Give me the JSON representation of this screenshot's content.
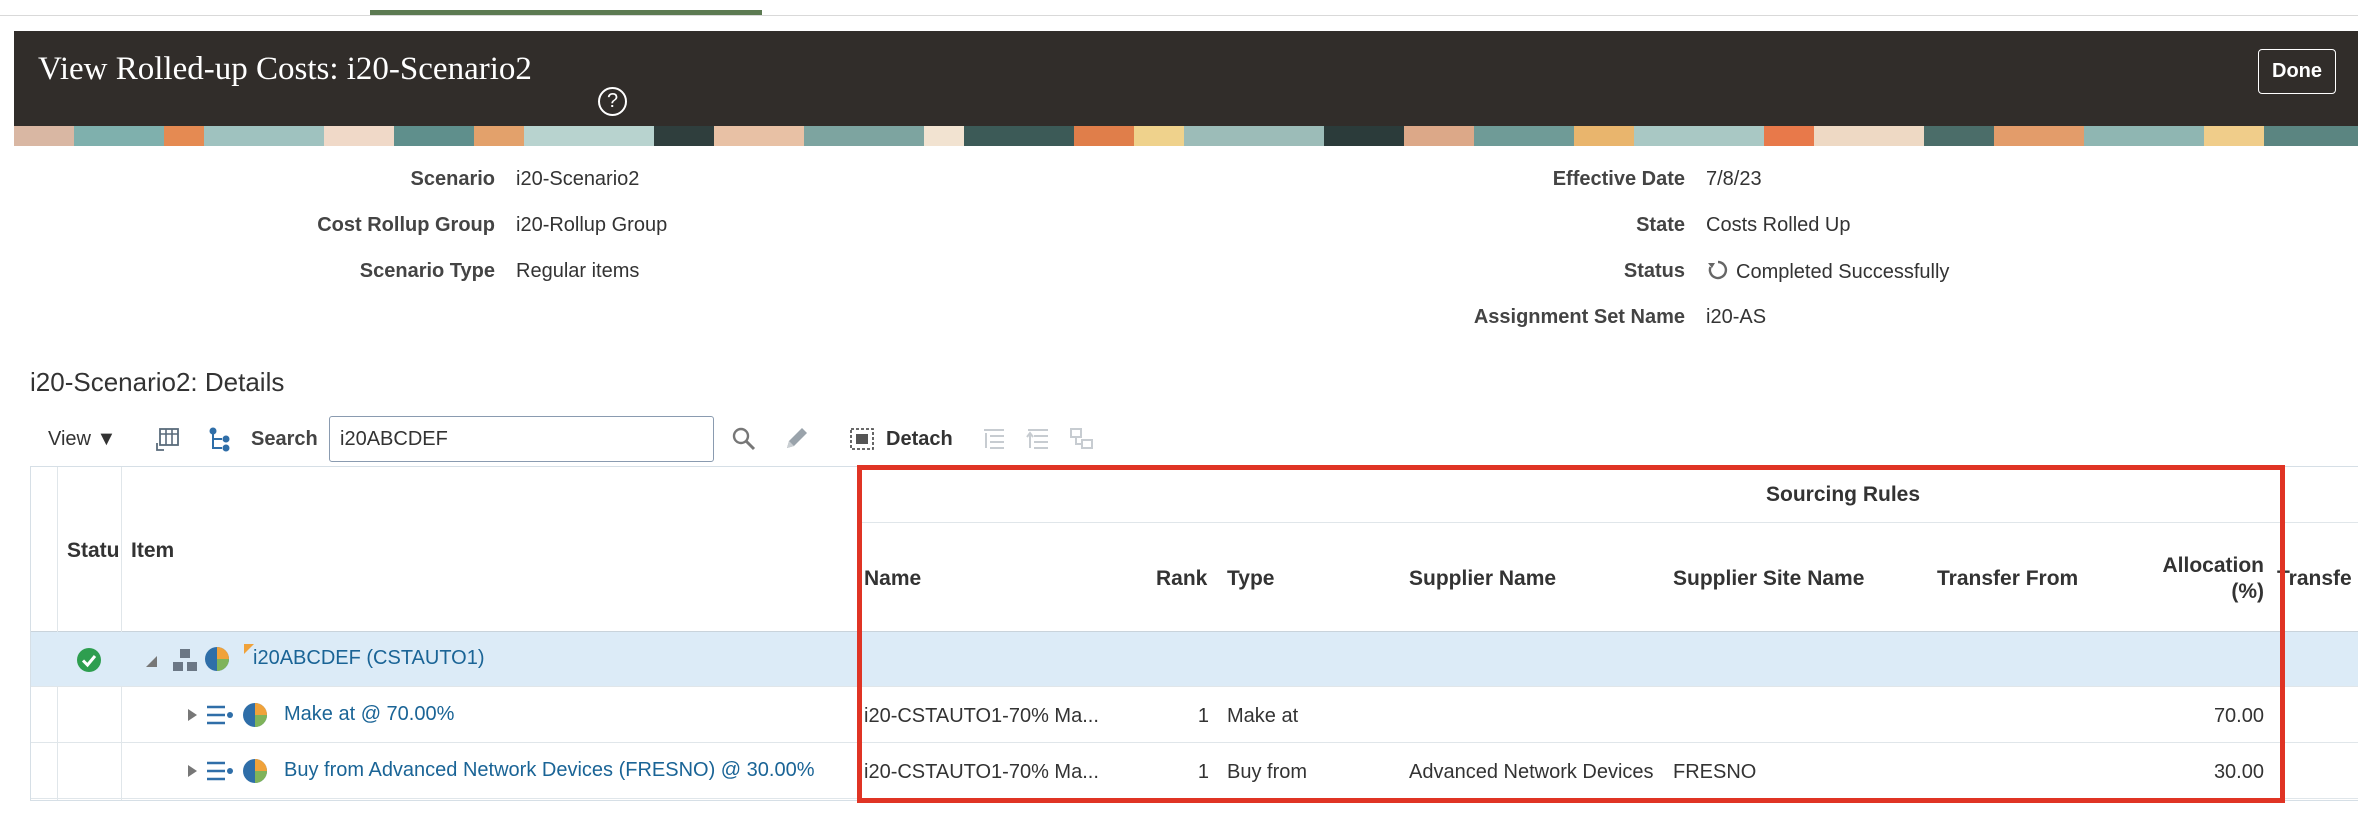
{
  "header": {
    "title": "View Rolled-up Costs: i20-Scenario2",
    "help_glyph": "?",
    "done_label": "Done"
  },
  "summary_left": [
    {
      "label": "Scenario",
      "value": "i20-Scenario2"
    },
    {
      "label": "Cost Rollup Group",
      "value": "i20-Rollup Group"
    },
    {
      "label": "Scenario Type",
      "value": "Regular items"
    }
  ],
  "summary_right": [
    {
      "label": "Effective Date",
      "value": "7/8/23"
    },
    {
      "label": "State",
      "value": "Costs Rolled Up"
    },
    {
      "label": "Status",
      "value": "Completed Successfully",
      "icon": "refresh-status-icon"
    },
    {
      "label": "Assignment Set Name",
      "value": "i20-AS"
    }
  ],
  "details": {
    "title": "i20-Scenario2: Details"
  },
  "toolbar": {
    "view_label": "View ▼",
    "search_label": "Search",
    "search_value": "i20ABCDEF",
    "detach_label": "Detach"
  },
  "table": {
    "group_header": "Sourcing Rules",
    "columns": {
      "status": "Statu",
      "item": "Item",
      "name": "Name",
      "rank": "Rank",
      "type": "Type",
      "supplier_name": "Supplier Name",
      "supplier_site": "Supplier Site Name",
      "transfer_from": "Transfer From",
      "allocation_line1": "Allocation",
      "allocation_line2": "(%)",
      "transfer_cut": "Transfe"
    },
    "rows": [
      {
        "item": "i20ABCDEF (CSTAUTO1)",
        "name": "",
        "rank": "",
        "type": "",
        "supplier_name": "",
        "supplier_site": "",
        "transfer_from": "",
        "allocation": ""
      },
      {
        "item": "Make at @ 70.00%",
        "name": "i20-CSTAUTO1-70% Ma...",
        "rank": "1",
        "type": "Make at",
        "supplier_name": "",
        "supplier_site": "",
        "transfer_from": "",
        "allocation": "70.00"
      },
      {
        "item": "Buy from Advanced Network Devices (FRESNO) @ 30.00%",
        "name": "i20-CSTAUTO1-70% Ma...",
        "rank": "1",
        "type": "Buy from",
        "supplier_name": "Advanced Network Devices",
        "supplier_site": "FRESNO",
        "transfer_from": "",
        "allocation": "30.00"
      }
    ]
  },
  "colors": {
    "header_bg": "#312d2a",
    "accent_green": "#5c7a52",
    "selected_row": "#dcebf7",
    "link": "#1a6496",
    "highlight_box": "#e03424",
    "success": "#2e9e4f"
  }
}
